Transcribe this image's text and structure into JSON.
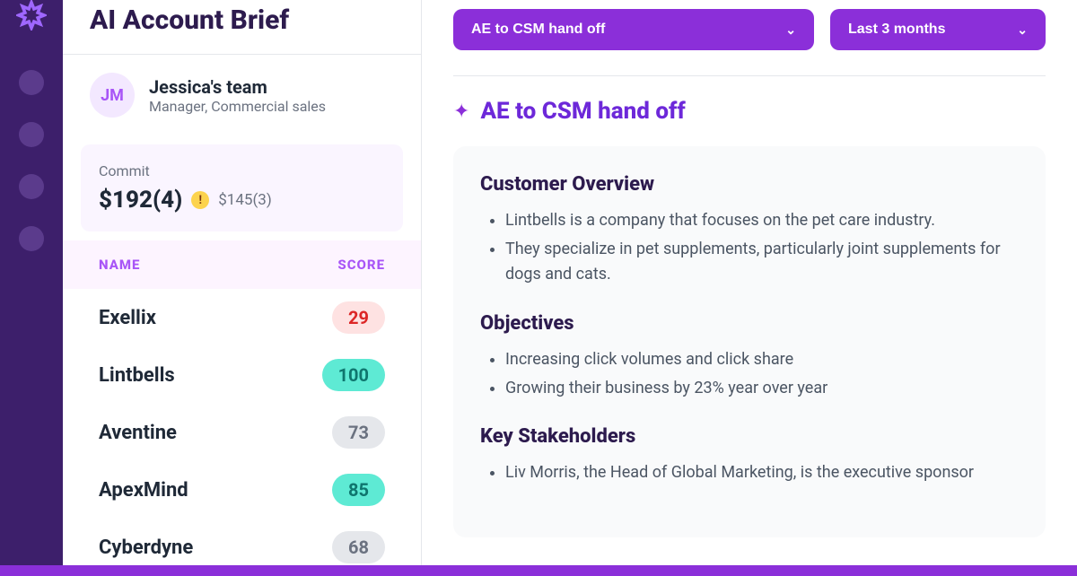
{
  "page_title": "AI Account Brief",
  "team": {
    "initials": "JM",
    "name": "Jessica's team",
    "role": "Manager, Commercial sales"
  },
  "commit": {
    "label": "Commit",
    "value": "$192(4)",
    "secondary": "$145(3)"
  },
  "table": {
    "headers": {
      "name": "NAME",
      "score": "SCORE"
    },
    "rows": [
      {
        "name": "Exellix",
        "score": "29",
        "tone": "red"
      },
      {
        "name": "Lintbells",
        "score": "100",
        "tone": "green"
      },
      {
        "name": "Aventine",
        "score": "73",
        "tone": "gray"
      },
      {
        "name": "ApexMind",
        "score": "85",
        "tone": "green"
      },
      {
        "name": "Cyberdyne",
        "score": "68",
        "tone": "gray"
      }
    ]
  },
  "filters": {
    "view": "AE to CSM hand off",
    "range": "Last 3 months"
  },
  "brief": {
    "heading": "AE to CSM hand off",
    "sections": [
      {
        "title": "Customer Overview",
        "items": [
          "Lintbells is a company that focuses on the pet care industry.",
          "They specialize in pet supplements, particularly joint supplements for dogs and cats."
        ]
      },
      {
        "title": "Objectives",
        "items": [
          "Increasing click volumes and click share",
          "Growing their business by 23% year over year"
        ]
      },
      {
        "title": "Key Stakeholders",
        "items": [
          "Liv Morris, the Head of Global Marketing, is the executive sponsor"
        ]
      }
    ]
  }
}
